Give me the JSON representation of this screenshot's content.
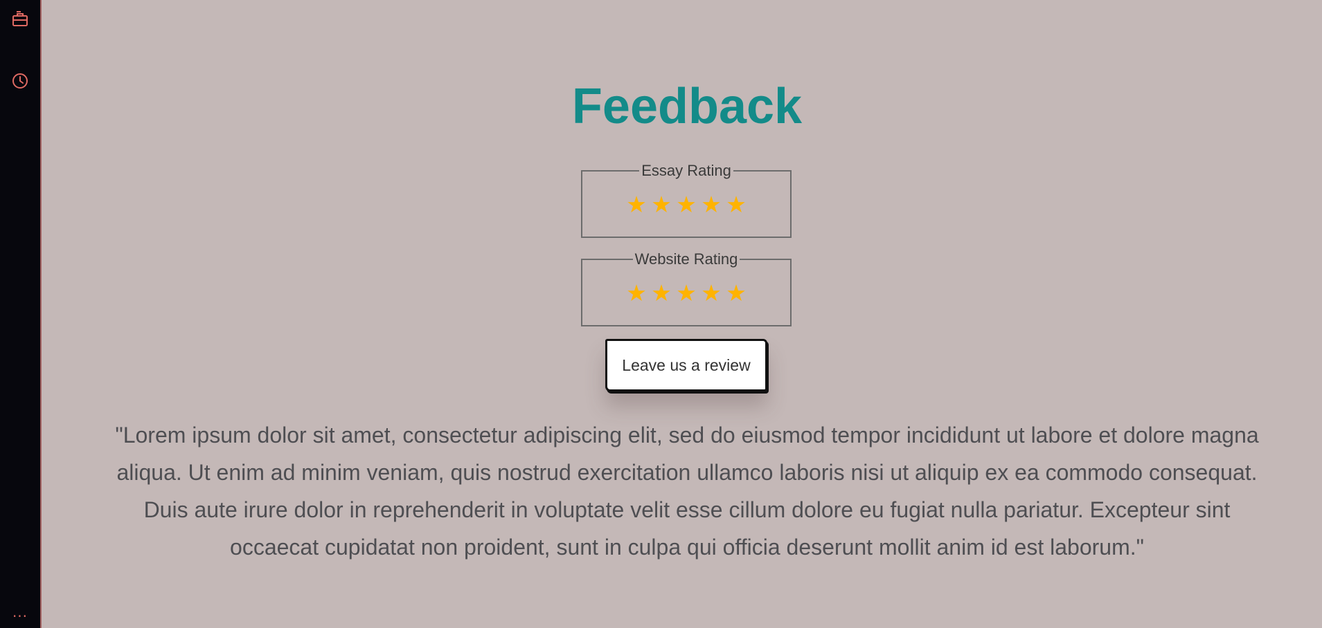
{
  "sidebar": {
    "items": [
      {
        "icon": "briefcase-icon",
        "label": ""
      },
      {
        "icon": "clock-icon",
        "label": ""
      }
    ],
    "more": "..."
  },
  "page": {
    "title": "Feedback"
  },
  "ratings": [
    {
      "label": "Essay Rating",
      "stars": 5,
      "max": 5
    },
    {
      "label": "Website Rating",
      "stars": 5,
      "max": 5
    }
  ],
  "review_button": {
    "label": "Leave us a review"
  },
  "quote": {
    "lines": [
      "\"Lorem ipsum dolor sit amet, consectetur adipiscing elit, sed do eiusmod tempor incididunt ut labore et dolore magna",
      "aliqua. Ut enim ad minim veniam, quis nostrud exercitation ullamco laboris nisi ut aliquip ex ea commodo consequat.",
      "Duis aute irure dolor in reprehenderit in voluptate velit esse cillum dolore eu fugiat nulla pariatur. Excepteur sint",
      "occaecat cupidatat non proident, sunt in culpa qui officia deserunt mollit anim id est laborum.\""
    ]
  },
  "colors": {
    "background": "#c4b8b7",
    "sidebar": "#07070d",
    "title": "#138b89",
    "star": "#ffb300",
    "sidebar_icon": "#e06a63"
  }
}
